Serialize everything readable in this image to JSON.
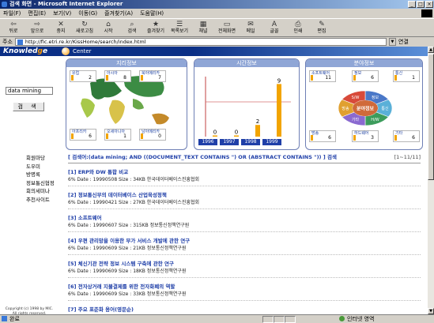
{
  "window": {
    "title": "검색 화면 - Microsoft Internet Explorer"
  },
  "menu": [
    "파일(F)",
    "편집(E)",
    "보기(V)",
    "이동(G)",
    "즐겨찾기(A)",
    "도움말(H)"
  ],
  "toolbar": [
    {
      "label": "뒤로",
      "icon": "back-arrow-icon",
      "glyph": "⇦"
    },
    {
      "label": "앞으로",
      "icon": "forward-arrow-icon",
      "glyph": "⇨"
    },
    {
      "label": "중지",
      "icon": "stop-icon",
      "glyph": "✕"
    },
    {
      "label": "새로고침",
      "icon": "refresh-icon",
      "glyph": "↻"
    },
    {
      "label": "시작",
      "icon": "home-icon",
      "glyph": "⌂"
    },
    {
      "label": "검색",
      "icon": "search-icon",
      "glyph": "⌕"
    },
    {
      "label": "즐겨찾기",
      "icon": "favorites-icon",
      "glyph": "★"
    },
    {
      "label": "목록보기",
      "icon": "history-icon",
      "glyph": "☰"
    },
    {
      "label": "채널",
      "icon": "channels-icon",
      "glyph": "▦"
    },
    {
      "label": "전체화면",
      "icon": "fullscreen-icon",
      "glyph": "▭"
    },
    {
      "label": "메일",
      "icon": "mail-icon",
      "glyph": "✉"
    },
    {
      "label": "글꼴",
      "icon": "font-icon",
      "glyph": "A"
    },
    {
      "label": "인쇄",
      "icon": "print-icon",
      "glyph": "⎙"
    },
    {
      "label": "편집",
      "icon": "edit-icon",
      "glyph": "✎"
    }
  ],
  "address": {
    "label": "주소",
    "url": "http://fic.etri.re.kr/KissHome/search/index.html",
    "links_label": "연결"
  },
  "brand": {
    "name_pre": "Knowled",
    "name_mid": "g",
    "name_post": "e",
    "suffix": "Center"
  },
  "sidebar": {
    "search_value": "data mining",
    "search_button": "검 색",
    "links": [
      "회원마당",
      "도우미",
      "방명록",
      "정보통신협정",
      "회의세미나",
      "추천사이트"
    ],
    "copyright": "Copyright (c) 1998 by MIC. All rights reserved."
  },
  "panels": {
    "region": {
      "title": "지리정보",
      "tags": [
        {
          "name": "유럽",
          "value": "2"
        },
        {
          "name": "아시아",
          "value": "8"
        },
        {
          "name": "북아메리카",
          "value": "7"
        },
        {
          "name": "아프리카",
          "value": "6"
        },
        {
          "name": "오세아니아",
          "value": "1"
        },
        {
          "name": "남아메리카",
          "value": "0"
        }
      ]
    },
    "time": {
      "title": "시간정보",
      "chart_data": {
        "type": "bar",
        "categories": [
          "1996",
          "1997",
          "1998",
          "1999"
        ],
        "values": [
          0,
          0,
          2,
          9
        ],
        "title": "",
        "xlabel": "",
        "ylabel": "",
        "ylim": [
          0,
          10
        ]
      }
    },
    "domain": {
      "title": "분야정보",
      "center_label": "분야정보",
      "tags": [
        {
          "name": "소프트웨어",
          "value": "11"
        },
        {
          "name": "정보",
          "value": "6"
        },
        {
          "name": "통신",
          "value": "1"
        },
        {
          "name": "방송",
          "value": "6"
        },
        {
          "name": "하드웨어",
          "value": "3"
        },
        {
          "name": "기타",
          "value": "6"
        }
      ],
      "segments": [
        "정보",
        "통신",
        "H/W",
        "기타",
        "방송",
        "S/W"
      ]
    }
  },
  "results": {
    "query": "[ 검색어:(data mining; AND ((DOCUMENT_TEXT CONTAINS \") OR (ABSTRACT CONTAINS \")) ] 검색",
    "count": "[1~11/11]",
    "items": [
      {
        "title": "[1] ERP와 DW 통합 비교",
        "meta": "6%  Date : 19990508  Size : 34KB  한국데이터베이스진흥협회"
      },
      {
        "title": "[2] 정보통신부의 데이터베이스 산업육성정책",
        "meta": "6%  Date : 19990421  Size : 27KB  한국데이터베이스진흥협회"
      },
      {
        "title": "[3] 소프트웨어",
        "meta": "6%  Date : 19990607  Size : 315KB  정보통신정책연구원"
      },
      {
        "title": "[4] 우편 관리망을 이용한 부가 서비스 개발에 관한 연구",
        "meta": "6%  Date : 19990609  Size : 21KB  정보통신정책연구원"
      },
      {
        "title": "[5] 체신기관 전략 정보 시스템 구축에 관한 연구",
        "meta": "6%  Date : 19990609  Size : 18KB  정보통신정책연구원"
      },
      {
        "title": "[6] 전자상거래 지불결제를 위한 전자화폐의 역할",
        "meta": "6%  Date : 19990609  Size : 33KB  정보통신정책연구원"
      },
      {
        "title": "[7] 주요 표준화 용어(영문순)",
        "meta": ""
      }
    ]
  },
  "status": {
    "text": "완료",
    "zone": "인터넷 영역"
  },
  "colors": {
    "accent": "#1f3fa8",
    "bar": "#f2a400",
    "brand": "#0b2f86"
  }
}
